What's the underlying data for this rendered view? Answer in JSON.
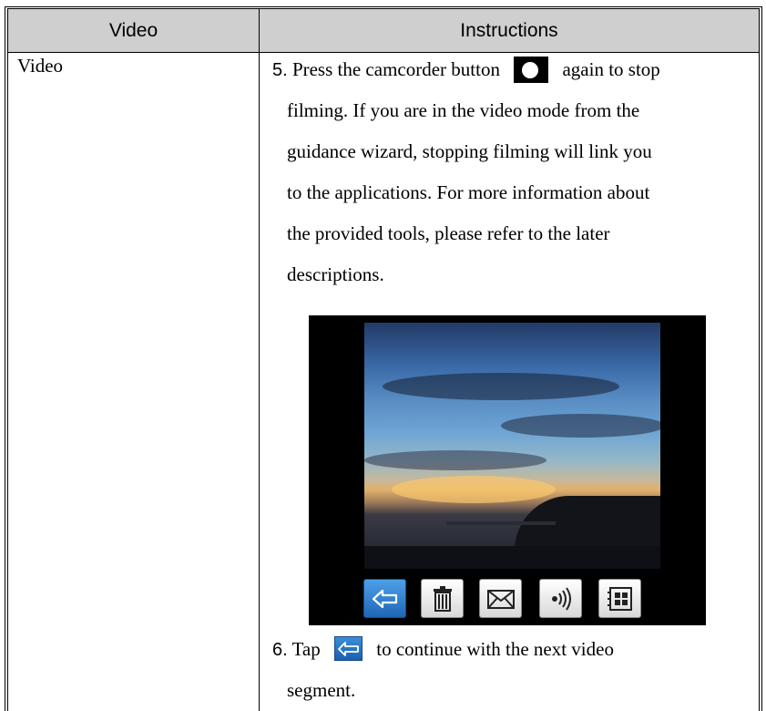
{
  "header": {
    "col1": "Video",
    "col2": "Instructions"
  },
  "row": {
    "label": "Video"
  },
  "step5": {
    "number": "5.",
    "line1_before": "Press the camcorder button",
    "line1_after": "again to stop",
    "line2": "filming. If you are in the video mode from the",
    "line3": "guidance wizard, stopping filming will link you",
    "line4": "to the applications. For more information about",
    "line5": "the provided tools, please refer to the later",
    "line6": "descriptions."
  },
  "step6": {
    "number": "6.",
    "line1_before": "Tap",
    "line1_after": "to continue with the next video",
    "line2": "segment."
  },
  "icons": {
    "camcorder": "camera-icon",
    "back": "back-arrow-icon",
    "toolbar": [
      "back-arrow-icon",
      "trash-icon",
      "mail-icon",
      "sound-icon",
      "grid-icon"
    ]
  },
  "colors": {
    "header_bg": "#cfcfcf",
    "active_button": "#1f66b8"
  }
}
